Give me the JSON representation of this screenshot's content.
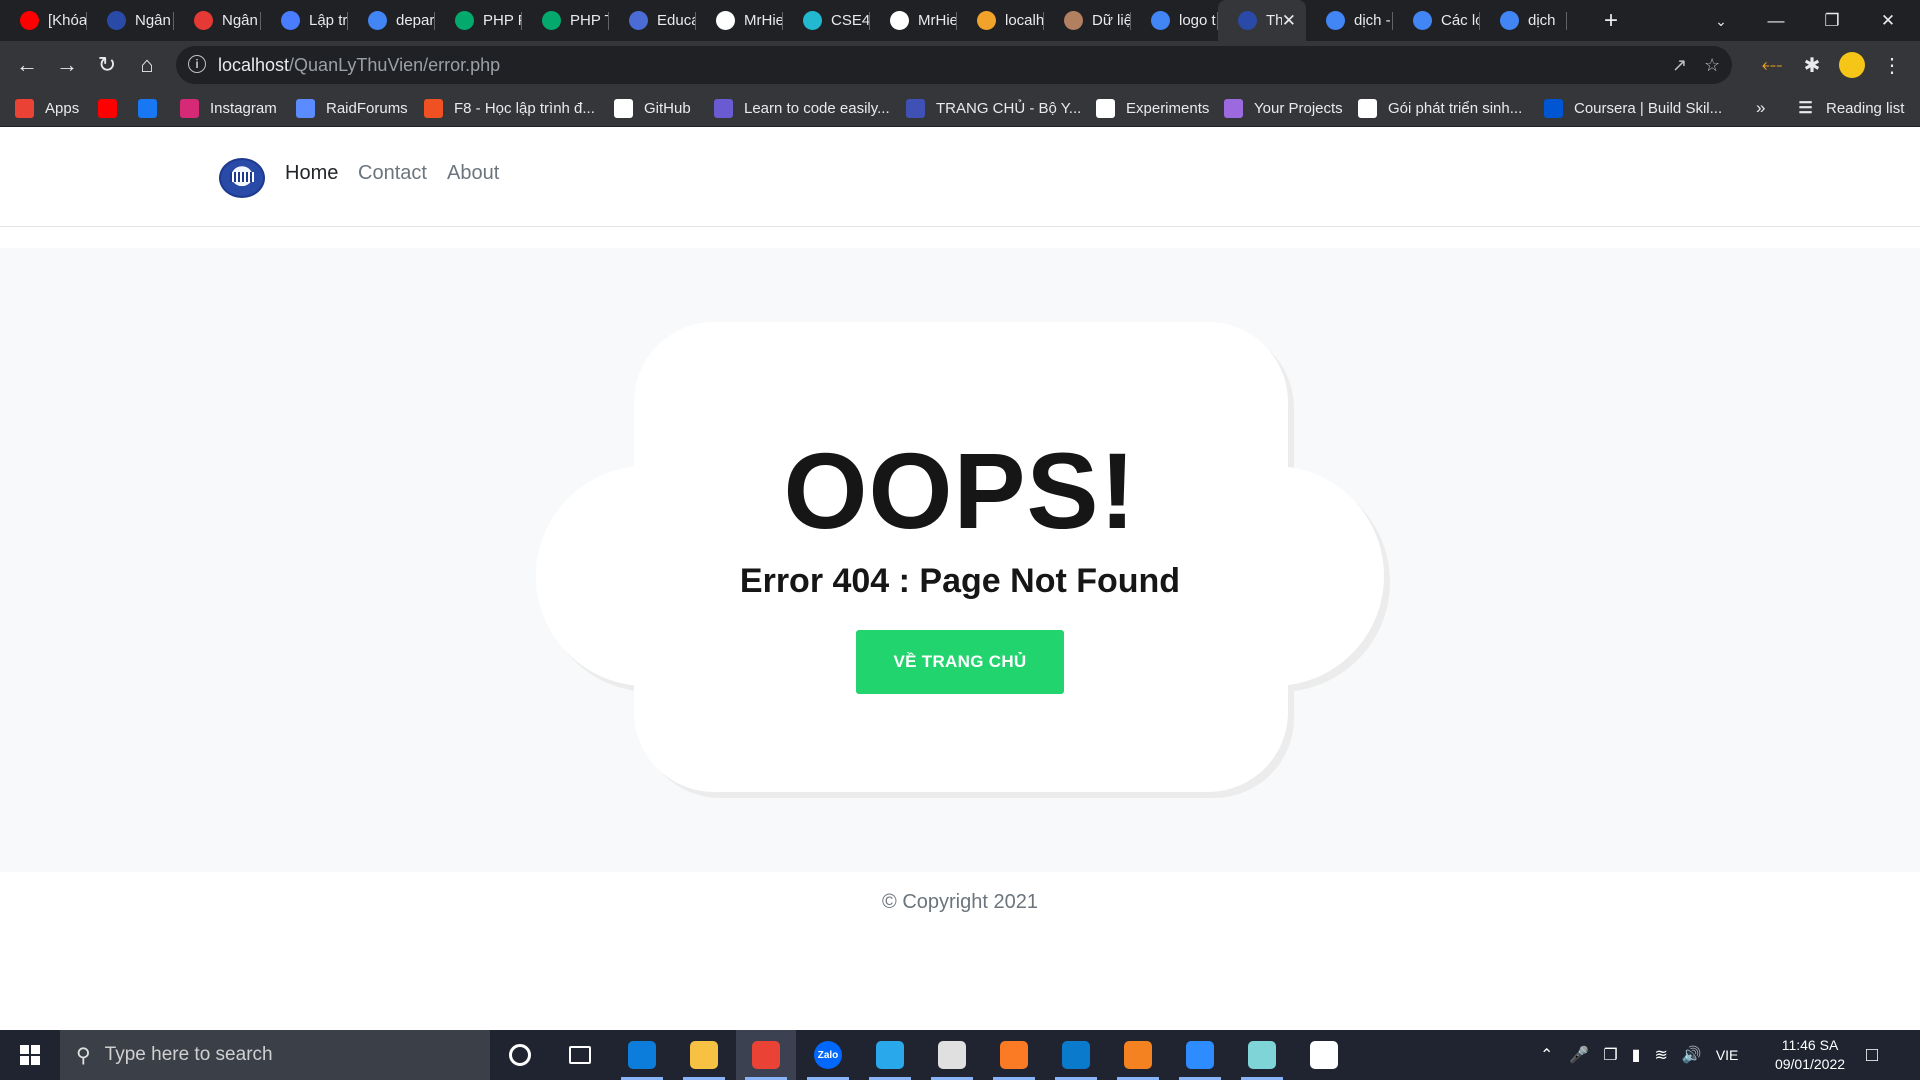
{
  "browser": {
    "tabs": [
      {
        "title": "[Khóa",
        "icon": "youtube-icon",
        "color": "#ff0000"
      },
      {
        "title": "Ngân",
        "icon": "library-logo-icon",
        "color": "#2a4aa8"
      },
      {
        "title": "Ngân",
        "icon": "calendar-icon",
        "color": "#e53935"
      },
      {
        "title": "Lập tr",
        "icon": "v-logo-icon",
        "color": "#4a7cff"
      },
      {
        "title": "depar",
        "icon": "google-icon",
        "color": "#4285f4"
      },
      {
        "title": "PHP F",
        "icon": "w3schools-icon",
        "color": "#04aa6d"
      },
      {
        "title": "PHP T",
        "icon": "w3schools-icon",
        "color": "#04aa6d"
      },
      {
        "title": "Educa",
        "icon": "education-site-icon",
        "color": "#4a6cd4"
      },
      {
        "title": "MrHie",
        "icon": "github-icon",
        "color": "#ffffff"
      },
      {
        "title": "CSE4",
        "icon": "cse-icon",
        "color": "#22b8cf"
      },
      {
        "title": "MrHie",
        "icon": "github-icon",
        "color": "#ffffff"
      },
      {
        "title": "localh",
        "icon": "xampp-icon",
        "color": "#f0a22a"
      },
      {
        "title": "Dữ liệ",
        "icon": "avatar-icon",
        "color": "#b08060"
      },
      {
        "title": "logo t",
        "icon": "google-icon",
        "color": "#4285f4"
      },
      {
        "title": "Th",
        "icon": "library-logo-icon",
        "color": "#2a4aa8",
        "active": true
      },
      {
        "title": "dịch -",
        "icon": "google-icon",
        "color": "#4285f4"
      },
      {
        "title": "Các lo",
        "icon": "google-icon",
        "color": "#4285f4"
      },
      {
        "title": "dịch",
        "icon": "google-icon",
        "color": "#4285f4"
      }
    ],
    "address": {
      "host": "localhost",
      "path": "/QuanLyThuVien/error.php"
    },
    "bookmarks": [
      {
        "label": "Apps",
        "icon": "apps-grid-icon",
        "color": "#ea4335"
      },
      {
        "label": "",
        "icon": "youtube-icon",
        "color": "#ff0000"
      },
      {
        "label": "",
        "icon": "facebook-icon",
        "color": "#1877f2"
      },
      {
        "label": "Instagram",
        "icon": "instagram-icon",
        "color": "#d62976"
      },
      {
        "label": "RaidForums",
        "icon": "raidforums-icon",
        "color": "#5b8cff"
      },
      {
        "label": "F8 - Học lập trình đ...",
        "icon": "f8-icon",
        "color": "#f05123"
      },
      {
        "label": "GitHub",
        "icon": "github-icon",
        "color": "#ffffff"
      },
      {
        "label": "Learn to code easily...",
        "icon": "learn-code-icon",
        "color": "#6b5bd2"
      },
      {
        "label": "TRANG CHỦ - Bộ Y...",
        "icon": "ministry-icon",
        "color": "#3f51b5"
      },
      {
        "label": "Experiments",
        "icon": "flask-icon",
        "color": "#ffffff"
      },
      {
        "label": "Your Projects",
        "icon": "projects-icon",
        "color": "#9c6ade"
      },
      {
        "label": "Gói phát triển sinh...",
        "icon": "github-icon",
        "color": "#ffffff"
      },
      {
        "label": "Coursera | Build Skil...",
        "icon": "coursera-icon",
        "color": "#0056d2"
      }
    ],
    "bookmarks_overflow": "»",
    "reading_list": "Reading list"
  },
  "site": {
    "nav": {
      "home": "Home",
      "contact": "Contact",
      "about": "About"
    },
    "error": {
      "title": "OOPS!",
      "subtitle": "Error 404 : Page Not Found",
      "button": "VỀ TRANG CHỦ"
    },
    "footer": "© Copyright 2021",
    "colors": {
      "button": "#21d46e",
      "hero_bg": "#f8f9fa",
      "text": "#161616"
    }
  },
  "taskbar": {
    "search_placeholder": "Type here to search",
    "apps": [
      {
        "name": "cortana-icon"
      },
      {
        "name": "task-view-icon"
      },
      {
        "name": "edge-icon",
        "color": "#0c7ddb"
      },
      {
        "name": "file-explorer-icon",
        "color": "#f7c244"
      },
      {
        "name": "chrome-icon",
        "color": "#ea4335",
        "active": true
      },
      {
        "name": "zalo-icon",
        "label": "Zalo",
        "color": "#0068ff"
      },
      {
        "name": "telegram-icon",
        "color": "#29a9eb"
      },
      {
        "name": "office-icon",
        "color": "#e0e0e0"
      },
      {
        "name": "xampp-icon",
        "color": "#fb7a24"
      },
      {
        "name": "vscode-icon",
        "color": "#0a7acc"
      },
      {
        "name": "pdf-icon",
        "color": "#f58220"
      },
      {
        "name": "zoom-icon",
        "color": "#2d8cff"
      },
      {
        "name": "tool-icon",
        "color": "#7fd4d8"
      },
      {
        "name": "notion-icon",
        "color": "#ffffff"
      }
    ],
    "language": "VIE",
    "time": "11:46 SA",
    "date": "09/01/2022"
  }
}
